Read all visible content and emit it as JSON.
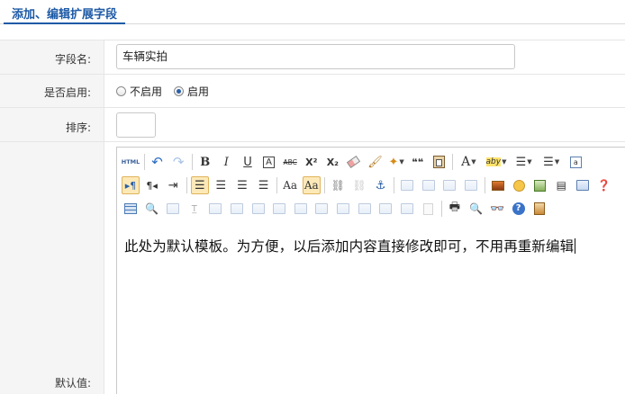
{
  "tab": {
    "title": "添加、编辑扩展字段"
  },
  "fields": {
    "name": {
      "label": "字段名:",
      "value": "车辆实拍"
    },
    "enable": {
      "label": "是否启用:",
      "options": [
        "不启用",
        "启用"
      ],
      "selected": "启用"
    },
    "sort": {
      "label": "排序:",
      "value": ""
    },
    "default": {
      "label": "默认值:"
    }
  },
  "editor": {
    "content": "此处为默认模板。为方便，以后添加内容直接修改即可，不用再重新编辑",
    "toolbar": {
      "html_label": "HTML",
      "bold": "B",
      "italic": "I",
      "underline": "U",
      "font_border": "A",
      "strike": "ABC",
      "superscript": "X²",
      "subscript": "X₂",
      "quote": "❝❝",
      "font_color": "A",
      "font_size": "aby"
    }
  },
  "colors": {
    "accent": "#1e5aa6",
    "label_bg": "#f5f5f5",
    "selected_btn": "#fde9b8"
  }
}
